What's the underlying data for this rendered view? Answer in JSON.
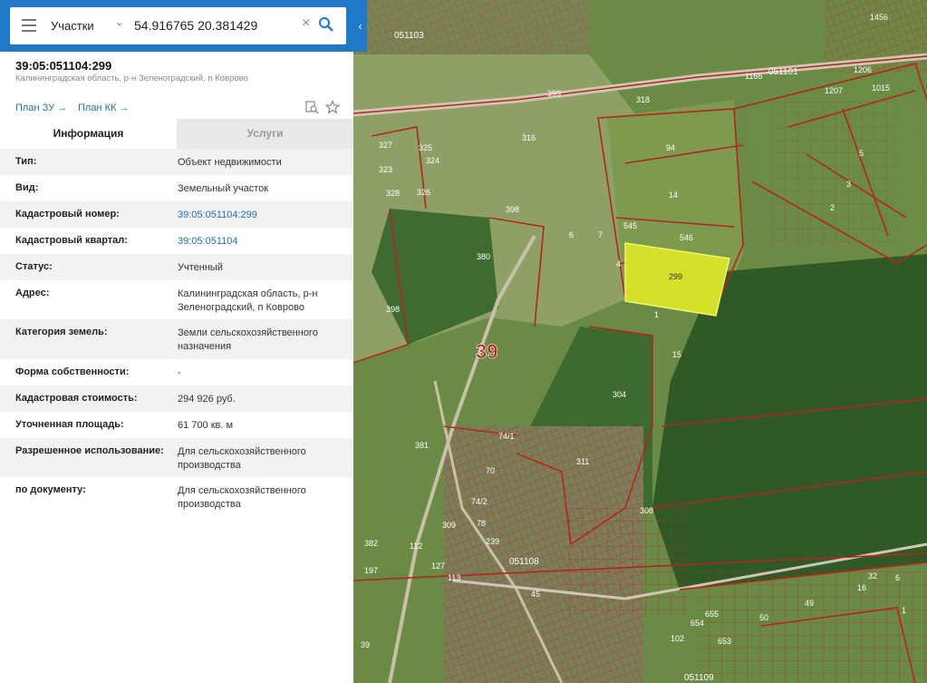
{
  "search": {
    "layer": "Участки",
    "query": "54.916765 20.381429"
  },
  "parcel": {
    "number": "39:05:051104:299",
    "address_short": "Калининградская область, р-н Зеленоградский, п Коврово"
  },
  "links": {
    "plan_zu": "План ЗУ →",
    "plan_kk": "План КК →"
  },
  "tabs": [
    {
      "label": "Информация"
    },
    {
      "label": "Услуги"
    }
  ],
  "info": [
    {
      "label": "Тип:",
      "value": "Объект недвижимости"
    },
    {
      "label": "Вид:",
      "value": "Земельный участок"
    },
    {
      "label": "Кадастровый номер:",
      "value": "39:05:051104:299"
    },
    {
      "label": "Кадастровый квартал:",
      "value": "39:05:051104"
    },
    {
      "label": "Статус:",
      "value": "Учтенный"
    },
    {
      "label": "Адрес:",
      "value": "Калининградская область, р-н Зеленоградский, п Коврово"
    },
    {
      "label": "Категория земель:",
      "value": "Земли сельскохозяйственного назначения"
    },
    {
      "label": "Форма собственности:",
      "value": "-"
    },
    {
      "label": "Кадастровая стоимость:",
      "value": "294 926 руб."
    },
    {
      "label": "Уточненная площадь:",
      "value": "61 700 кв. м"
    },
    {
      "label": "Разрешенное использование:",
      "value": "Для сельскохозяйственного производства"
    },
    {
      "label": "по документу:",
      "value": "Для сельскохозяйственного производства"
    }
  ],
  "map": {
    "region_label": "39",
    "selected_parcel": "299",
    "quarters": [
      "051103",
      "051101",
      "051108",
      "051109"
    ],
    "parcel_labels": [
      "1456",
      "1206",
      "1166",
      "1207",
      "1015",
      "399",
      "318",
      "316",
      "327",
      "325",
      "324",
      "323",
      "328",
      "326",
      "398",
      "94",
      "14",
      "545",
      "546",
      "5",
      "3",
      "2",
      "6",
      "7",
      "4",
      "1",
      "15",
      "380",
      "398",
      "304",
      "74/1",
      "381",
      "311",
      "70",
      "74/2",
      "308",
      "309",
      "78",
      "239",
      "382",
      "197",
      "112",
      "127",
      "113",
      "45",
      "102",
      "654",
      "655",
      "653",
      "32",
      "16",
      "49",
      "50",
      "6",
      "1",
      "39"
    ],
    "colors": {
      "header": "#1f78c8",
      "link": "#1f6fb4",
      "parcel_border": "#b3261e",
      "selected_fill": "#d4e02a"
    }
  }
}
